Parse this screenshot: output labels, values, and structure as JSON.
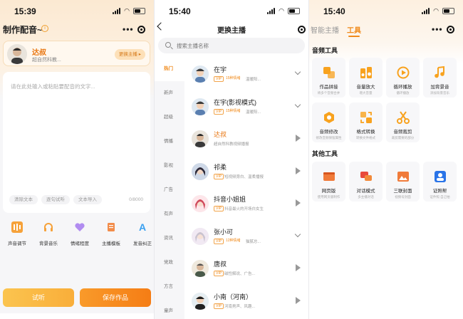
{
  "status": {
    "s1_time": "15:39",
    "s2_time": "15:40",
    "s3_time": "15:40"
  },
  "screen1": {
    "title": "制作配音~",
    "anchor": {
      "name": "达叔",
      "desc": "超自然科教..."
    },
    "change_anchor_label": "更换主播 ▸",
    "editor_placeholder": "请在此处输入或粘贴要配音的文字...",
    "editor_actions": [
      "清除文本",
      "逐句试听",
      "文本导入"
    ],
    "char_count": "0/8000",
    "tools": [
      "声音调节",
      "背景音乐",
      "情绪程度",
      "主播模板",
      "发音纠正"
    ],
    "listen_label": "试听",
    "save_label": "保存作品"
  },
  "screen2": {
    "title": "更换主播",
    "search_placeholder": "搜索主播名称",
    "categories": [
      "热门",
      "新声",
      "超级",
      "情播",
      "影视",
      "广告",
      "有声",
      "资讯",
      "党政",
      "方言",
      "童声"
    ],
    "anchors": [
      {
        "name": "在宇",
        "tag": "VIP",
        "badge": "15种情绪",
        "desc": "温暖阳...",
        "action": "expand"
      },
      {
        "name": "在宇(影视模式)",
        "tag": "VIP",
        "badge": "15种情绪",
        "desc": "温暖阳...",
        "action": "expand"
      },
      {
        "name": "达叔",
        "tag": "",
        "badge": "",
        "desc": "超自然科教视频播报",
        "action": "play"
      },
      {
        "name": "祁柔",
        "tag": "VIP",
        "badge": "",
        "desc": "短视频旁白、温柔播报",
        "action": "play"
      },
      {
        "name": "抖音小姐姐",
        "tag": "VIP",
        "badge": "",
        "desc": "抖音最火的开场白女生",
        "action": "play"
      },
      {
        "name": "张小可",
        "tag": "VIP",
        "badge": "12种情绪",
        "desc": "猫腻总...",
        "action": "expand"
      },
      {
        "name": "唐叔",
        "tag": "VIP",
        "badge": "",
        "desc": "磁性解说、广告...",
        "action": "play"
      },
      {
        "name": "小南（河南）",
        "tag": "VIP",
        "badge": "",
        "desc": "河南男声、风趣...",
        "action": "play"
      }
    ]
  },
  "screen3": {
    "tabs": [
      "智能主播",
      "工具"
    ],
    "audio_section": "音频工具",
    "other_section": "其他工具",
    "audio_tools": [
      {
        "name": "作品拼接",
        "desc": "将多个音频合并",
        "color": "#f8a21e"
      },
      {
        "name": "音量放大",
        "desc": "增大音量",
        "color": "#f8a21e"
      },
      {
        "name": "循环播放",
        "desc": "循环播放",
        "color": "#f8a21e"
      },
      {
        "name": "加背景音",
        "desc": "添加背景音乐",
        "color": "#f8a21e"
      },
      {
        "name": "音频修改",
        "desc": "修改音频保留属性",
        "color": "#f8a21e"
      },
      {
        "name": "格式转换",
        "desc": "转换文件格式",
        "color": "#f8a21e"
      },
      {
        "name": "音频裁剪",
        "desc": "裁剪需要的部分",
        "color": "#f8a21e"
      }
    ],
    "other_tools": [
      {
        "name": "网页版",
        "desc": "使用网页版制作",
        "color": "#f07b3a"
      },
      {
        "name": "对话模式",
        "desc": "多主播对话",
        "color": "#e84a3c"
      },
      {
        "name": "三联封面",
        "desc": "视频号封面",
        "color": "#f07b3a"
      },
      {
        "name": "证照帮",
        "desc": "证件照 自己拍",
        "color": "#2a74e8"
      }
    ]
  }
}
